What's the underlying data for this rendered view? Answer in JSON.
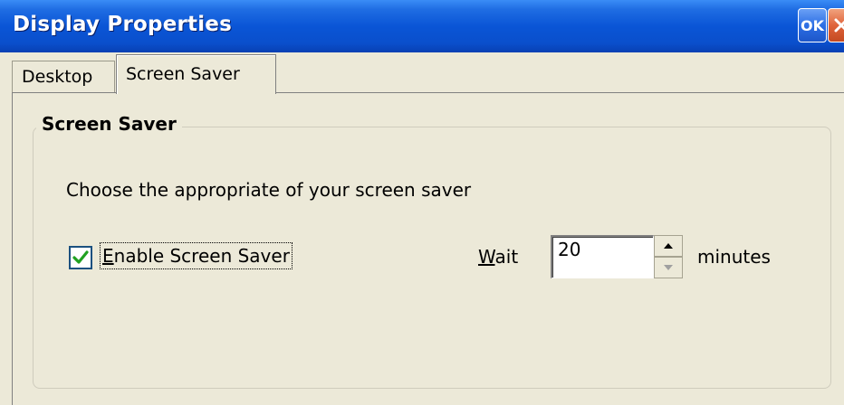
{
  "window": {
    "title": "Display Properties",
    "ok_label": "OK",
    "close_icon": "close-icon",
    "titlebar_color": "#0a55d6"
  },
  "tabs": [
    {
      "label": "Desktop",
      "selected": false
    },
    {
      "label": "Screen Saver",
      "selected": true
    }
  ],
  "screensaver": {
    "group_title": "Screen Saver",
    "description": "Choose the appropriate of your screen saver",
    "enable_mnemonic": "E",
    "enable_rest": "nable Screen Saver",
    "enable_checked": true,
    "wait_mnemonic": "W",
    "wait_rest": "ait",
    "wait_value": "20",
    "minutes_label": "minutes"
  }
}
